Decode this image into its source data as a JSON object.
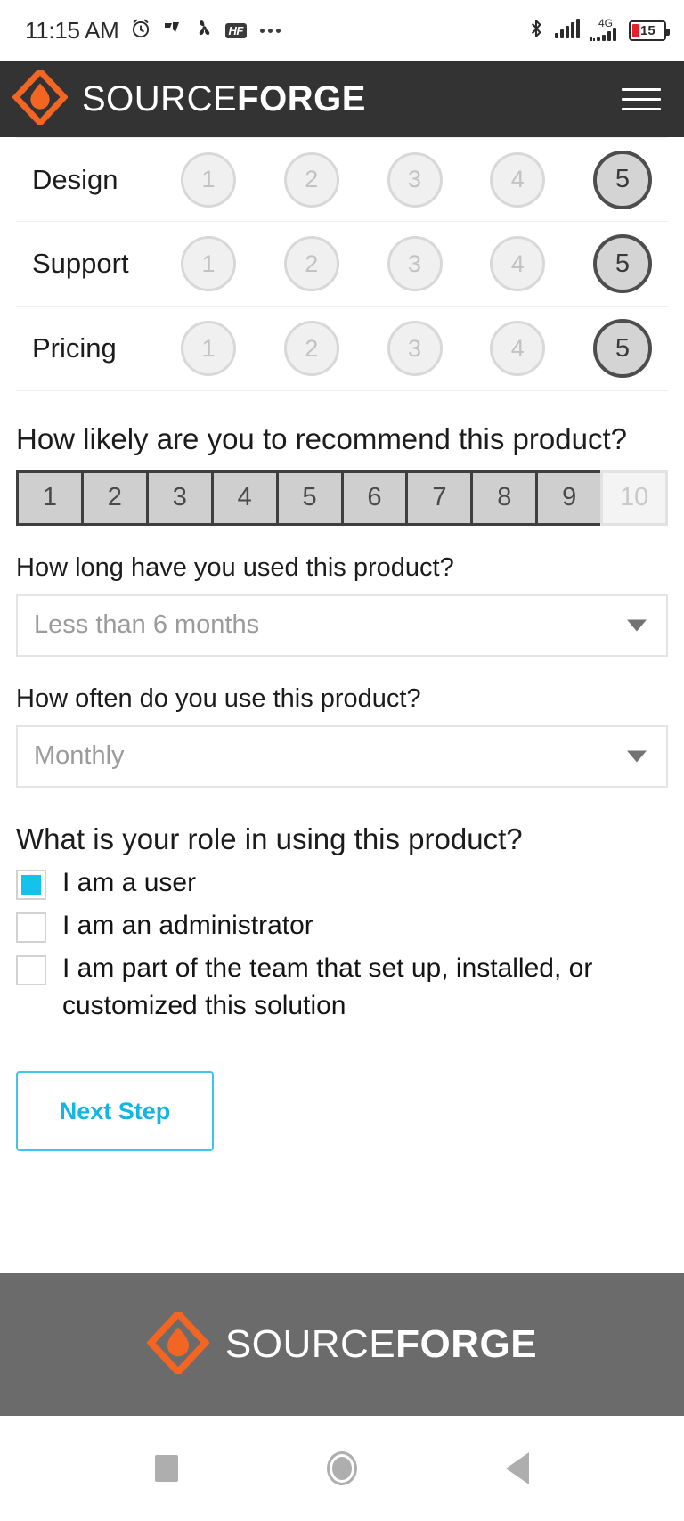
{
  "status_bar": {
    "time": "11:15 AM",
    "icons": [
      "alarm-clock-icon",
      "tiktok-icon",
      "fan-icon",
      "hf-badge-icon",
      "more-dots-icon"
    ],
    "hf_label": "HF",
    "network_type": "4G",
    "battery_percent": "15",
    "right_icons": [
      "bluetooth-icon",
      "wifi-signal-icon",
      "cellular-signal-icon",
      "battery-icon"
    ]
  },
  "header": {
    "brand_light": "SOURCE",
    "brand_bold": "FORGE",
    "menu_label": "menu"
  },
  "ratings": {
    "scale": [
      "1",
      "2",
      "3",
      "4",
      "5"
    ],
    "rows": [
      {
        "label": "Design",
        "selected": 5
      },
      {
        "label": "Support",
        "selected": 5
      },
      {
        "label": "Pricing",
        "selected": 5
      }
    ]
  },
  "nps": {
    "question": "How likely are you to recommend this product?",
    "values": [
      "1",
      "2",
      "3",
      "4",
      "5",
      "6",
      "7",
      "8",
      "9",
      "10"
    ],
    "muted_index": 9
  },
  "duration": {
    "question": "How long have you used this product?",
    "value": "Less than 6 months"
  },
  "frequency": {
    "question": "How often do you use this product?",
    "value": "Monthly"
  },
  "role": {
    "question": "What is your role in using this product?",
    "options": [
      {
        "label": "I am a user",
        "checked": true
      },
      {
        "label": "I am an administrator",
        "checked": false
      },
      {
        "label": "I am part of the team that set up, installed, or customized this solution",
        "checked": false
      }
    ]
  },
  "actions": {
    "next_step": "Next Step"
  },
  "footer": {
    "brand_light": "SOURCE",
    "brand_bold": "FORGE"
  },
  "navbar": {
    "recent": "recent-apps",
    "home": "home",
    "back": "back"
  },
  "colors": {
    "brand_orange": "#F26522",
    "header_dark": "#333333",
    "footer_gray": "#6B6B6B",
    "accent_cyan": "#14C3EC",
    "battery_red": "#E8202A"
  }
}
